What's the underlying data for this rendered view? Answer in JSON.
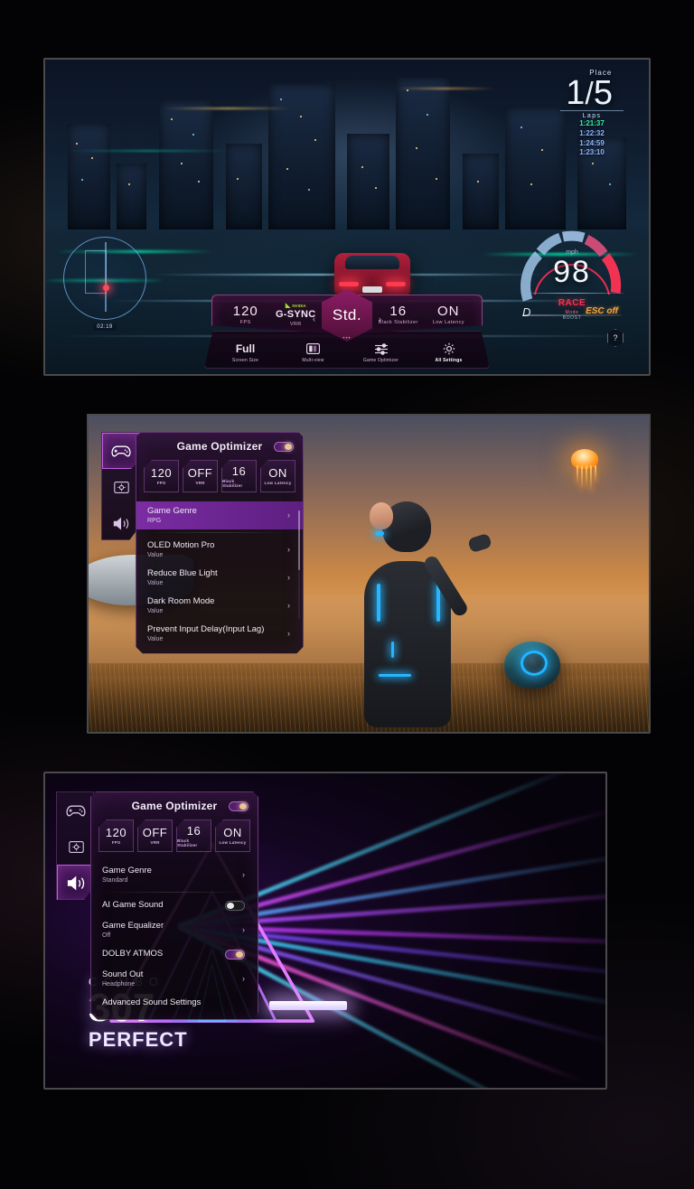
{
  "page": {
    "background_color": "#030305"
  },
  "panel_racing": {
    "name": "Game Bar / racing game screen",
    "hud": {
      "place_label": "Place",
      "place_value": "1",
      "place_total": "5",
      "laps_label": "Laps",
      "lap_times": [
        "1:21:37",
        "1:22:32",
        "1:24:59",
        "1:23:10"
      ],
      "minimap_time": "02:19"
    },
    "speedometer": {
      "unit": "mph",
      "value": "98",
      "mode": "RACE",
      "mode_sub": "Mode",
      "gear": "D",
      "esc": "ESC off",
      "boost_label": "BOOST"
    },
    "gamebar": {
      "stats": [
        {
          "value": "120",
          "key": "FPS"
        },
        {
          "value": "G-SYNC",
          "key": "VRR",
          "brand": "NVIDIA"
        },
        {
          "value": "16",
          "key": "Black Stabilizer"
        },
        {
          "value": "ON",
          "key": "Low Latency"
        }
      ],
      "preset": "Std.",
      "arrow_left": "‹",
      "arrow_right": "›",
      "menu": [
        {
          "value": "Full",
          "label": "Screen Size",
          "icon": "text"
        },
        {
          "value": "",
          "label": "Multi-view",
          "icon": "multiview-icon"
        },
        {
          "value": "",
          "label": "Game Optimizer",
          "icon": "sliders-icon"
        },
        {
          "value": "",
          "label": "All Settings",
          "icon": "gear-icon"
        }
      ],
      "help": "?"
    }
  },
  "panel_game": {
    "name": "Game Optimizer - picture menu over sci-fi game",
    "rail": [
      {
        "icon": "gamepad-icon",
        "active": true
      },
      {
        "icon": "display-icon",
        "active": false
      },
      {
        "icon": "speaker-icon",
        "active": false
      }
    ],
    "title": "Game Optimizer",
    "master_toggle": "on",
    "stats": [
      {
        "value": "120",
        "key": "FPS"
      },
      {
        "value": "OFF",
        "key": "VRR"
      },
      {
        "value": "16",
        "key": "Black Stabilizer"
      },
      {
        "value": "ON",
        "key": "Low Latency"
      }
    ],
    "rows": [
      {
        "label": "Game Genre",
        "value": "RPG",
        "control": "chevron",
        "selected": true
      },
      {
        "label": "OLED Motion Pro",
        "value": "Value",
        "control": "chevron",
        "selected": false
      },
      {
        "label": "Reduce Blue Light",
        "value": "Value",
        "control": "chevron",
        "selected": false
      },
      {
        "label": "Dark Room Mode",
        "value": "Value",
        "control": "chevron",
        "selected": false
      },
      {
        "label": "Prevent Input Delay(Input Lag)",
        "value": "Value",
        "control": "chevron",
        "selected": false
      }
    ],
    "chevron": "›"
  },
  "panel_sound": {
    "name": "Game Optimizer - sound menu over rhythm game",
    "rail": [
      {
        "icon": "gamepad-icon",
        "active": false
      },
      {
        "icon": "display-icon",
        "active": false
      },
      {
        "icon": "speaker-icon",
        "active": true
      }
    ],
    "title": "Game Optimizer",
    "master_toggle": "on",
    "stats": [
      {
        "value": "120",
        "key": "FPS"
      },
      {
        "value": "OFF",
        "key": "VRR"
      },
      {
        "value": "16",
        "key": "Black Stabilizer"
      },
      {
        "value": "ON",
        "key": "Low Latency"
      }
    ],
    "rows": [
      {
        "label": "Game Genre",
        "value": "Standard",
        "control": "chevron"
      },
      {
        "label": "AI Game Sound",
        "value": "",
        "control": "toggle",
        "toggle": "off"
      },
      {
        "label": "Game Equalizer",
        "value": "Off",
        "control": "chevron"
      },
      {
        "label": "DOLBY ATMOS",
        "value": "",
        "control": "toggle",
        "toggle": "on"
      },
      {
        "label": "Sound Out",
        "value": "Headphone",
        "control": "chevron"
      },
      {
        "label": "Advanced Sound Settings",
        "value": "",
        "control": "none"
      }
    ],
    "chevron": "›",
    "game_overlay": {
      "combo_label": "COMBO",
      "combo_value": "307",
      "judgement": "PERFECT"
    }
  }
}
